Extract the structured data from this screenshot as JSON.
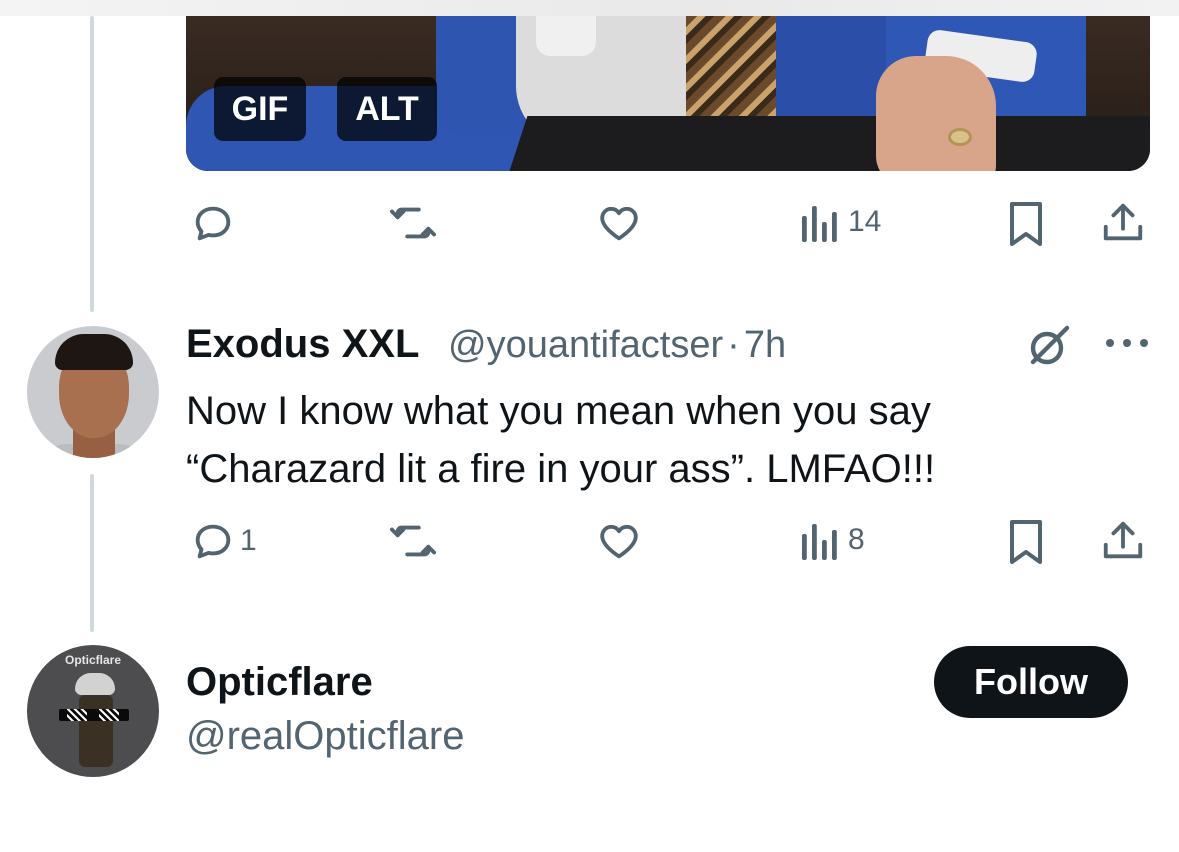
{
  "media": {
    "badges": {
      "gif": "GIF",
      "alt": "ALT"
    }
  },
  "media_actions": {
    "views_count": "14"
  },
  "reply_tweet": {
    "author_name": "Exodus XXL",
    "author_handle": "@youantifactser",
    "separator": "·",
    "time": "7h",
    "text_line1": "Now I know what you mean when you say",
    "text_line2": "“Charazard lit a fire in your ass”. LMFAO!!!",
    "reply_count": "1",
    "views_count": "8"
  },
  "suggested_user": {
    "avatar_label": "Opticflare",
    "name": "Opticflare",
    "handle": "@realOpticflare",
    "follow_label": "Follow"
  },
  "icons": [
    "reply-icon",
    "retweet-icon",
    "like-icon",
    "views-icon",
    "bookmark-icon",
    "share-icon",
    "grok-icon",
    "more-icon"
  ],
  "colors": {
    "text": "#0f1419",
    "muted": "#536471",
    "thread_line": "#cfd9de",
    "follow_bg": "#0f1419"
  }
}
